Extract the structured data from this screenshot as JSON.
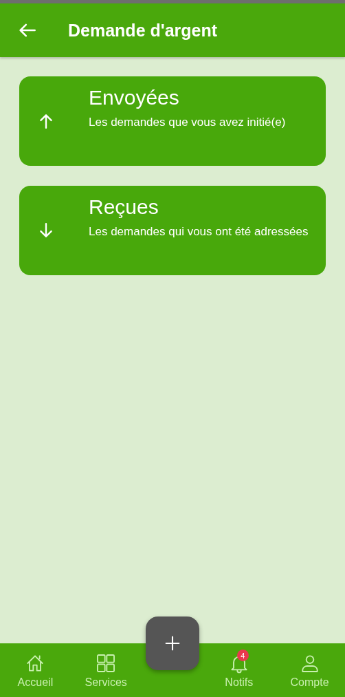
{
  "header": {
    "title": "Demande d'argent"
  },
  "cards": [
    {
      "kind": "up",
      "title": "Envoyées",
      "subtitle": "Les demandes que vous avez initié(e)"
    },
    {
      "kind": "down",
      "title": "Reçues",
      "subtitle": "Les demandes qui vous ont été adressées"
    }
  ],
  "nav": [
    {
      "kind": "home",
      "label": "Accueil"
    },
    {
      "kind": "grid",
      "label": "Services"
    },
    {
      "kind": "fab"
    },
    {
      "kind": "bell",
      "label": "Notifs",
      "badge": "4"
    },
    {
      "kind": "person",
      "label": "Compte"
    }
  ]
}
